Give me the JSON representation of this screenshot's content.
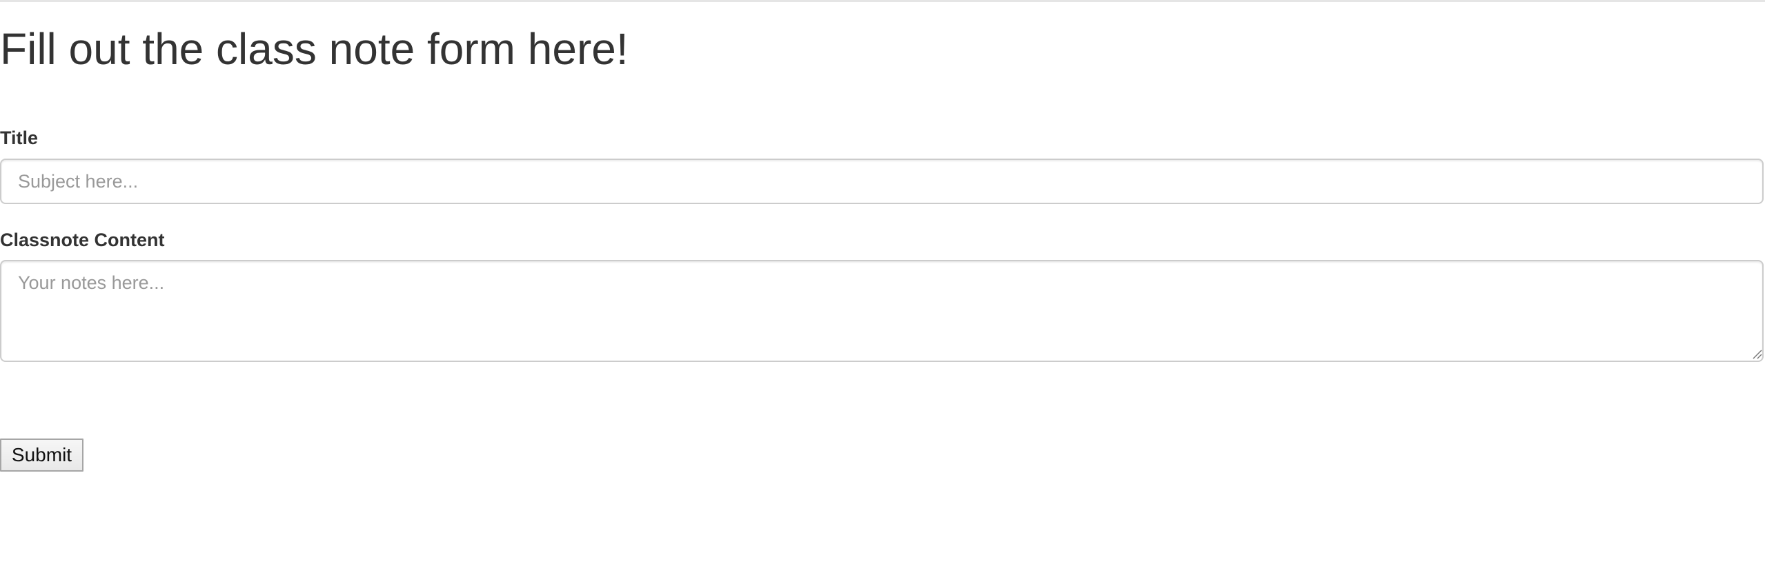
{
  "page": {
    "heading": "Fill out the class note form here!"
  },
  "form": {
    "title_label": "Title",
    "title_placeholder": "Subject here...",
    "title_value": "",
    "content_label": "Classnote Content",
    "content_placeholder": "Your notes here...",
    "content_value": "",
    "submit_label": "Submit"
  },
  "colors": {
    "text": "#333333",
    "placeholder": "#999999",
    "input_border": "#cccccc"
  },
  "icons": {
    "textarea_resize": "resize-grip-icon"
  }
}
